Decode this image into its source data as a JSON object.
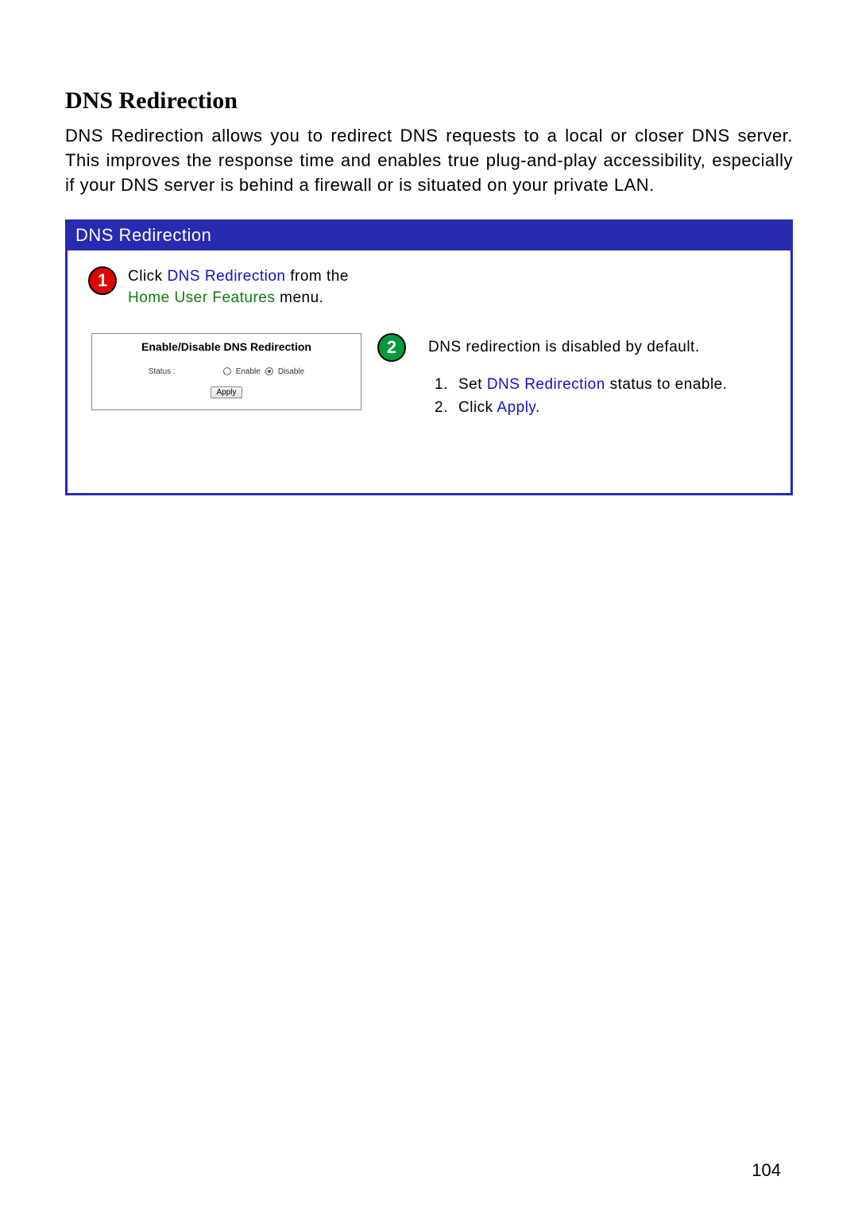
{
  "title": "DNS Redirection",
  "intro": "DNS Redirection allows you to redirect DNS requests to a local or closer DNS server. This improves the response time and enables true plug-and-play accessibility, especially if your DNS server is behind a firewall or is situated on your private LAN.",
  "box": {
    "header": "DNS Redirection",
    "step1": {
      "badge": "1",
      "pre": "Click ",
      "link1": "DNS Redirection",
      "mid": " from the ",
      "link2": "Home User Features",
      "post": " menu."
    },
    "screenshot": {
      "title": "Enable/Disable DNS Redirection",
      "status_label": "Status :",
      "enable_label": "Enable",
      "disable_label": "Disable",
      "apply_label": "Apply"
    },
    "step2": {
      "badge": "2",
      "default_text": "DNS redirection is disabled by default.",
      "items": [
        {
          "num": "1.",
          "pre": "Set ",
          "link": "DNS Redirection",
          "post": " status to enable."
        },
        {
          "num": "2.",
          "pre": "Click ",
          "link": "Apply",
          "post": "."
        }
      ]
    }
  },
  "page_number": "104"
}
